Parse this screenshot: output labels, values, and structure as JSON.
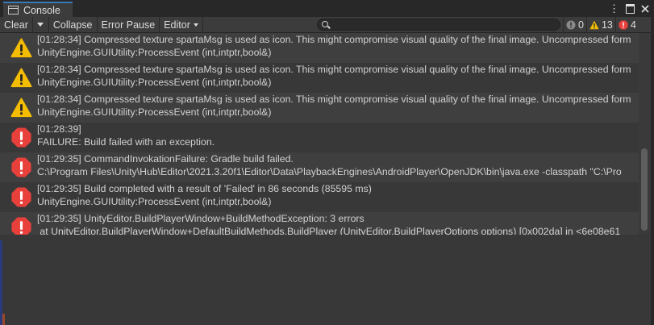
{
  "window": {
    "tab_label": "Console",
    "menu_glyph": "⋮",
    "icons": [
      "console-icon",
      "more-options-icon",
      "maximize-icon",
      "close-icon"
    ]
  },
  "toolbar": {
    "clear_label": "Clear",
    "collapse_label": "Collapse",
    "error_pause_label": "Error Pause",
    "editor_label": "Editor",
    "search_value": "",
    "counts": {
      "info": "0",
      "warning": "13",
      "error": "4"
    }
  },
  "entries": [
    {
      "type": "warning",
      "line1": "[01:28:34] Compressed texture spartaMsg is used as icon. This might compromise visual quality of the final image. Uncompressed form",
      "line2": "UnityEngine.GUIUtility:ProcessEvent (int,intptr,bool&)"
    },
    {
      "type": "warning",
      "line1": "[01:28:34] Compressed texture spartaMsg is used as icon. This might compromise visual quality of the final image. Uncompressed form",
      "line2": "UnityEngine.GUIUtility:ProcessEvent (int,intptr,bool&)"
    },
    {
      "type": "warning",
      "line1": "[01:28:34] Compressed texture spartaMsg is used as icon. This might compromise visual quality of the final image. Uncompressed form",
      "line2": "UnityEngine.GUIUtility:ProcessEvent (int,intptr,bool&)"
    },
    {
      "type": "error",
      "line1": "[01:28:39]",
      "line2": "FAILURE: Build failed with an exception."
    },
    {
      "type": "error",
      "line1": "[01:29:35] CommandInvokationFailure: Gradle build failed.",
      "line2": "C:\\Program Files\\Unity\\Hub\\Editor\\2021.3.20f1\\Editor\\Data\\PlaybackEngines\\AndroidPlayer\\OpenJDK\\bin\\java.exe -classpath \"C:\\Pro"
    },
    {
      "type": "error",
      "line1": "[01:29:35] Build completed with a result of 'Failed' in 86 seconds (85595 ms)",
      "line2": "UnityEngine.GUIUtility:ProcessEvent (int,intptr,bool&)"
    },
    {
      "type": "error",
      "line1": "[01:29:35] UnityEditor.BuildPlayerWindow+BuildMethodException: 3 errors",
      "line2": " at UnityEditor.BuildPlayerWindow+DefaultBuildMethods.BuildPlayer (UnityEditor.BuildPlayerOptions options) [0x002da] in <6e08e61"
    }
  ],
  "colors": {
    "warning": "#f4bc02",
    "error": "#e8413c",
    "tab_accent": "#3a79bb"
  }
}
